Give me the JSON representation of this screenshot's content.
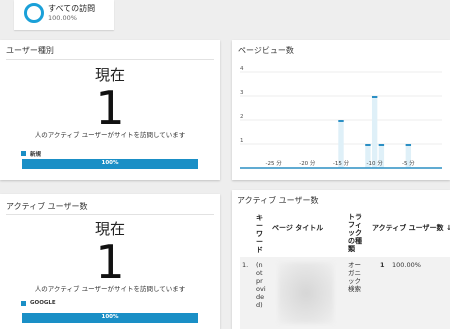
{
  "segment": {
    "title": "すべての訪問",
    "subtitle": "100.00%"
  },
  "user_type_card": {
    "title": "ユーザー種別",
    "now_label": "現在",
    "count": "1",
    "caption": "人のアクティブ ユーザーがサイトを訪問しています",
    "legend_label": "新規",
    "bar_label": "100%",
    "bar_value": 1.0,
    "accent": "#1a8fc6"
  },
  "active_users_card": {
    "title": "アクティブ ユーザー数",
    "now_label": "現在",
    "count": "1",
    "caption": "人のアクティブ ユーザーがサイトを訪問しています",
    "legend_label": "GOOGLE",
    "bar_label": "100%",
    "bar_value": 1.0
  },
  "pageviews_card": {
    "title": "ページビュー数"
  },
  "chart_data": {
    "type": "bar",
    "y_ticks": [
      "1",
      "2",
      "3",
      "4"
    ],
    "ylim": [
      0,
      4.5
    ],
    "x_ticks": [
      {
        "label": "-25 分",
        "minute": -25
      },
      {
        "label": "-20 分",
        "minute": -20
      },
      {
        "label": "-15 分",
        "minute": -15
      },
      {
        "label": "-10 分",
        "minute": -10
      },
      {
        "label": "-5 分",
        "minute": -5
      }
    ],
    "xlim": [
      -30,
      0
    ],
    "bars": [
      {
        "minute": -15,
        "value": 2
      },
      {
        "minute": -11,
        "value": 1
      },
      {
        "minute": -10,
        "value": 3
      },
      {
        "minute": -9,
        "value": 1
      },
      {
        "minute": -5,
        "value": 1
      }
    ],
    "grid": true,
    "bar_color": "#2b8fc4",
    "bar_fill": "#dff0f8"
  },
  "top_pages_card": {
    "title": "アクティブ ユーザー数",
    "headers": {
      "keyword": [
        "キ",
        "ー",
        "ワ",
        "ー",
        "ド"
      ],
      "page_title": "ページ タイトル",
      "traffic_type": [
        "トラ",
        "フィ",
        "ック",
        "の種",
        "類"
      ],
      "active_users": "アクティブ ユーザー数 ↓"
    },
    "rows": [
      {
        "index": "1.",
        "keyword": [
          "(n",
          "ot",
          "pr",
          "ovi",
          "de",
          "d)"
        ],
        "traffic_type": [
          "オー",
          "ガニ",
          "ック",
          "検索"
        ],
        "count": "1",
        "percent": "100.00%"
      }
    ]
  }
}
